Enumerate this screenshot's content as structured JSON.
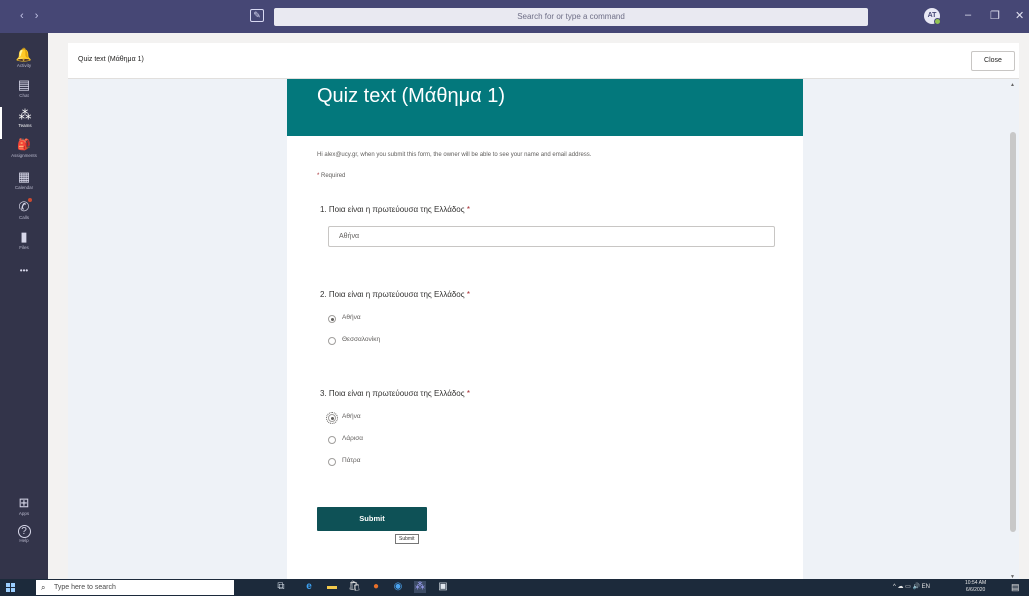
{
  "titlebar": {
    "search_placeholder": "Search for or type a command",
    "avatar_initials": "AT",
    "nav_arrows": "‹ ›",
    "minimize": "–",
    "maximize": "❐",
    "close": "✕"
  },
  "rail": {
    "items": [
      {
        "label": "Activity",
        "icon": "bell-icon",
        "glyph": "🔔"
      },
      {
        "label": "Chat",
        "icon": "chat-icon",
        "glyph": "▤"
      },
      {
        "label": "Teams",
        "icon": "teams-icon",
        "glyph": "⁂"
      },
      {
        "label": "Assignments",
        "icon": "assignments-icon",
        "glyph": "🎒"
      },
      {
        "label": "Calendar",
        "icon": "calendar-icon",
        "glyph": "▦"
      },
      {
        "label": "Calls",
        "icon": "phone-icon",
        "glyph": "✆"
      },
      {
        "label": "Files",
        "icon": "file-icon",
        "glyph": "▮"
      },
      {
        "label": "",
        "icon": "more-icon",
        "glyph": "•••"
      }
    ],
    "bottom": [
      {
        "label": "Apps",
        "icon": "apps-icon",
        "glyph": "⊞"
      },
      {
        "label": "Help",
        "icon": "help-icon",
        "glyph": "?"
      }
    ]
  },
  "header": {
    "title": "Quiz text (Μάθημα 1)",
    "close_label": "Close"
  },
  "form": {
    "title": "Quiz text (Μάθημα 1)",
    "notice": "Hi alex@ucy.gr, when you submit this form, the owner will be able to see your name and email address.",
    "required_label": "Required",
    "questions": [
      {
        "title": "1. Ποια είναι η πρωτεύουσα της Ελλάδος",
        "answer": "Αθήνα"
      },
      {
        "title": "2. Ποια είναι η πρωτεύουσα της Ελλάδος",
        "options": [
          "Αθήνα",
          "Θεσσαλονίκη"
        ],
        "selected": 0
      },
      {
        "title": "3. Ποια είναι η πρωτεύουσα της Ελλάδος",
        "options": [
          "Αθήνα",
          "Λάρισα",
          "Πάτρα"
        ],
        "selected": 0
      }
    ],
    "submit_label": "Submit",
    "submit_tooltip": "Submit"
  },
  "taskbar": {
    "search_placeholder": "Type here to search",
    "tray_lang": "EN",
    "time": "10:54 AM",
    "date": "6/6/2020"
  },
  "colors": {
    "banner": "#03787c",
    "submit": "#0e5156",
    "titlebar": "#464775",
    "rail": "#33344a"
  }
}
